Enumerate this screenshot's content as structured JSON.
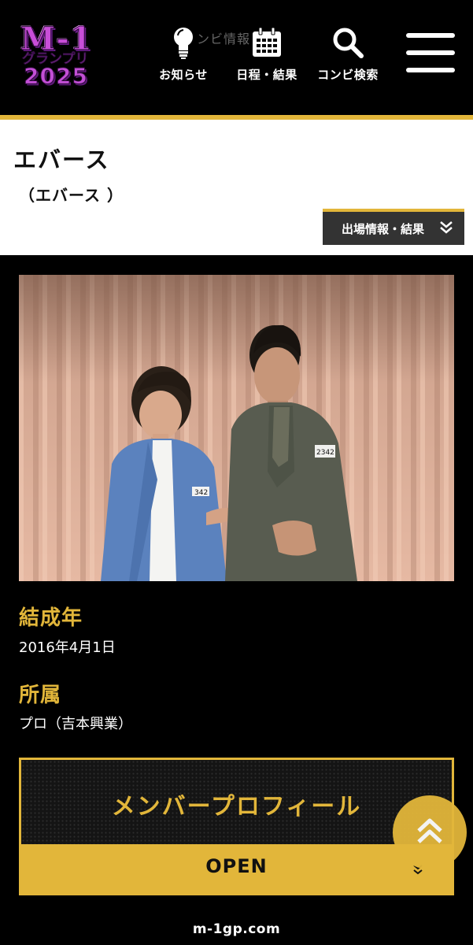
{
  "header": {
    "logo": {
      "line1": "M-1",
      "line2": "グランプリ",
      "line3": "2025"
    },
    "ghost_text": "ンビ情報",
    "nav": [
      {
        "label": "お知らせ",
        "icon": "lightbulb-icon"
      },
      {
        "label": "日程・結果",
        "icon": "calendar-icon"
      },
      {
        "label": "コンビ検索",
        "icon": "search-icon"
      }
    ],
    "menu_icon": "hamburger-menu-icon",
    "accent_color": "#e2b63a"
  },
  "combi": {
    "name": "エバース",
    "kana": "（エバース ）",
    "result_button": "出場情報・結果"
  },
  "info": {
    "formed_label": "結成年",
    "formed_value": "2016年4月1日",
    "affiliation_label": "所属",
    "affiliation_value": "プロ（吉本興業）"
  },
  "profile": {
    "title": "メンバープロフィール",
    "open_label": "OPEN"
  },
  "photo": {
    "badge_left": "342",
    "badge_right": "2342"
  },
  "footer": {
    "url": "m-1gp.com"
  }
}
